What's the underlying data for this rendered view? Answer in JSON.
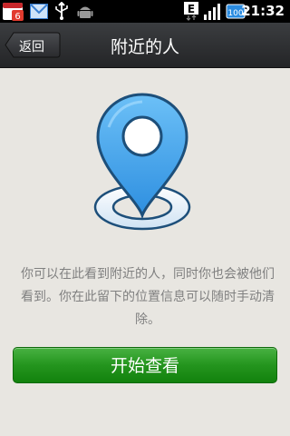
{
  "status_bar": {
    "calendar_badge": "6",
    "battery_level": "100",
    "network_type": "E",
    "time": "21:32",
    "icons": [
      "calendar-icon",
      "mail-icon",
      "usb-icon",
      "android-debug-icon",
      "data-e-icon",
      "signal-icon",
      "battery-icon"
    ]
  },
  "title_bar": {
    "back_label": "返回",
    "title": "附近的人"
  },
  "illustration": {
    "icon": "location-pin-icon",
    "colors": {
      "pin": "#4aa8ee",
      "pin_outline": "#1d4f7a",
      "ring_fill": "#dbe9f5"
    }
  },
  "main": {
    "description": "你可以在此看到附近的人，同时你也会被他们看到。你在此留下的位置信息可以随时手动清除。",
    "start_button_label": "开始查看",
    "accent_color": "#24951e"
  }
}
